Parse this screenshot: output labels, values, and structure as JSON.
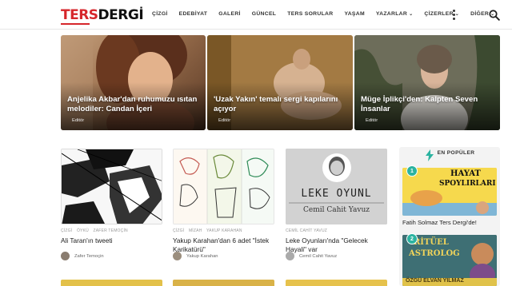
{
  "logo": {
    "part1": "TERS",
    "part2": "DERGİ"
  },
  "nav": {
    "items": [
      {
        "label": "ÇİZGİ",
        "has_dropdown": false
      },
      {
        "label": "EDEBİYAT",
        "has_dropdown": false
      },
      {
        "label": "GALERİ",
        "has_dropdown": false
      },
      {
        "label": "GÜNCEL",
        "has_dropdown": false
      },
      {
        "label": "TERS SORULAR",
        "has_dropdown": false
      },
      {
        "label": "YAŞAM",
        "has_dropdown": false
      },
      {
        "label": "YAZARLAR",
        "has_dropdown": true
      },
      {
        "label": "ÇİZERLER",
        "has_dropdown": true
      },
      {
        "label": "DİĞER",
        "has_dropdown": true
      }
    ]
  },
  "hero": [
    {
      "title": "Anjelika Akbar'dan ruhumuzu ısıtan melodiler: Candan İçeri",
      "author": "Editör"
    },
    {
      "title": "'Uzak Yakın' temalı sergi kapılarını açıyor",
      "author": "Editör"
    },
    {
      "title": "Müge İplikçi'den: Kalpten Seven İnsanlar",
      "author": "Editör"
    }
  ],
  "cards": [
    {
      "meta": [
        "ÇİZGİ",
        "ÖYKÜ",
        "ZAFER TEMOÇİN"
      ],
      "title": "Ali Taran'ın tweeti",
      "author": "Zafer Temoçin"
    },
    {
      "meta": [
        "ÇİZGİ",
        "MİZAH",
        "YAKUP KARAHAN"
      ],
      "title": "Yakup Karahan'dan 6 adet \"İstek Karikatürü\"",
      "author": "Yakup Karahan"
    },
    {
      "meta": [
        "CEMİL CAHİT YAVUZ"
      ],
      "title": "Leke Oyunları'nda \"Gelecek Hayali\" var",
      "author": "Cemil Cahit Yavuz",
      "image_text_1": "LEKE OYUNL",
      "image_text_2": "Cemil Cahit Yavuz"
    }
  ],
  "sidebar": {
    "heading": "EN POPÜLER",
    "items": [
      {
        "rank": "1",
        "title": "Fatih Solmaz Ters Dergi'de!",
        "image_text_1": "HAYAT",
        "image_text_2": "SPOYLIRLARI"
      },
      {
        "rank": "2",
        "title": "",
        "image_text_1": "RİTÜEL",
        "image_text_2": "ASTROLOG",
        "image_text_3": "ÖZGÜ ELVAN YILMAZ"
      }
    ]
  },
  "colors": {
    "brand_red": "#d6262b",
    "accent_teal": "#2bb3a0"
  }
}
